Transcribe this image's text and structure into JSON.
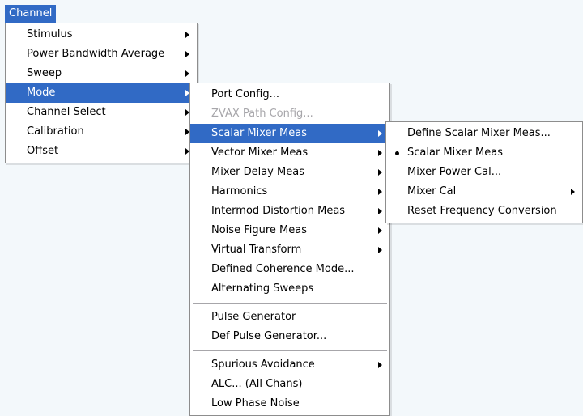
{
  "menubar": {
    "channel_label": "Channel"
  },
  "channel_menu": {
    "items": [
      {
        "label": "Stimulus"
      },
      {
        "label": "Power Bandwidth Average"
      },
      {
        "label": "Sweep"
      },
      {
        "label": "Mode"
      },
      {
        "label": "Channel Select"
      },
      {
        "label": "Calibration"
      },
      {
        "label": "Offset"
      }
    ]
  },
  "mode_menu": {
    "items": [
      {
        "label": "Port Config..."
      },
      {
        "label": "ZVAX Path Config..."
      },
      {
        "label": "Scalar Mixer Meas"
      },
      {
        "label": "Vector Mixer Meas"
      },
      {
        "label": "Mixer Delay Meas"
      },
      {
        "label": "Harmonics"
      },
      {
        "label": "Intermod Distortion Meas"
      },
      {
        "label": "Noise Figure Meas"
      },
      {
        "label": "Virtual Transform"
      },
      {
        "label": "Defined Coherence Mode..."
      },
      {
        "label": "Alternating Sweeps"
      },
      {
        "label": "Pulse Generator"
      },
      {
        "label": "Def Pulse Generator..."
      },
      {
        "label": "Spurious Avoidance"
      },
      {
        "label": "ALC... (All Chans)"
      },
      {
        "label": "Low Phase Noise"
      }
    ]
  },
  "scalar_menu": {
    "items": [
      {
        "label": "Define Scalar Mixer Meas..."
      },
      {
        "label": "Scalar Mixer Meas"
      },
      {
        "label": "Mixer Power Cal..."
      },
      {
        "label": "Mixer Cal"
      },
      {
        "label": "Reset Frequency Conversion"
      }
    ]
  },
  "colors": {
    "highlight": "#316ac5",
    "disabled_text": "#a7a6aa",
    "background": "#f3f8fb"
  },
  "icons": {
    "submenu_arrow": "chevron-right-icon",
    "checked_bullet": "bullet-icon"
  }
}
